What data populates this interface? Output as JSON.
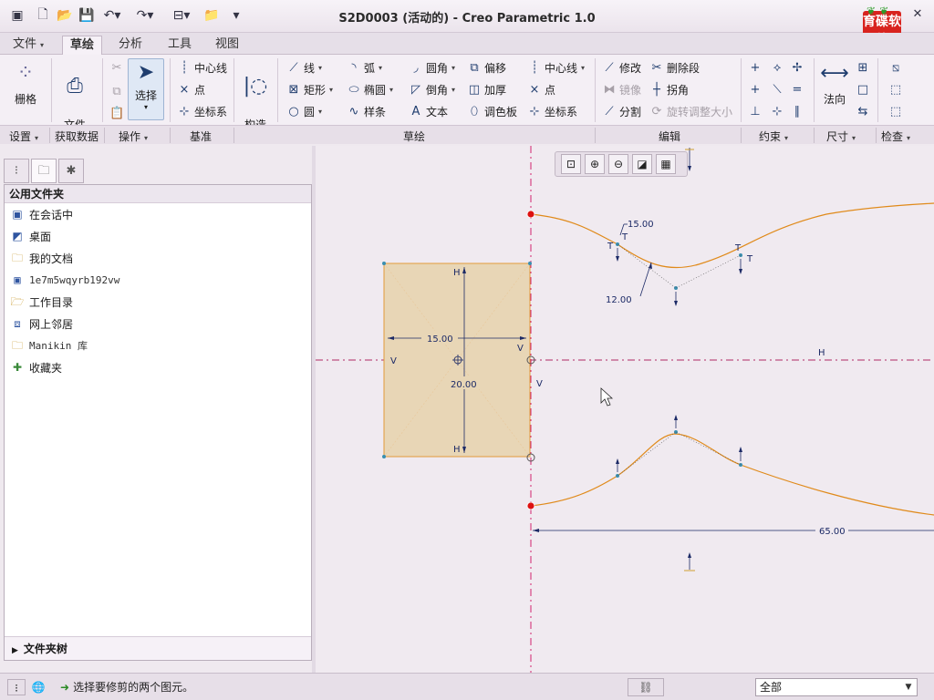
{
  "window": {
    "title": "S2D0003 (活动的) - Creo Parametric 1.0"
  },
  "logo": {
    "text": "育碟软件"
  },
  "quick_access": [
    "app-icon",
    "new-icon",
    "open-icon",
    "save-icon",
    "undo-icon",
    "redo-icon",
    "window-icon",
    "folder-icon",
    "customize-icon"
  ],
  "menu": {
    "tabs": [
      {
        "label": "文件"
      },
      {
        "label": "草绘"
      },
      {
        "label": "分析"
      },
      {
        "label": "工具"
      },
      {
        "label": "视图"
      }
    ]
  },
  "ribbon": {
    "grid": "栅格",
    "file_system": "文件\n系统",
    "select": "选择",
    "centerline": "中心线",
    "point": "点",
    "coordsys": "坐标系",
    "construct_mode": "构造\n模式",
    "sketch": {
      "line": "线",
      "rectangle": "矩形",
      "circle": "圆",
      "arc": "弧",
      "ellipse": "椭圆",
      "spline": "样条",
      "fillet": "圆角",
      "chamfer": "倒角",
      "text": "文本",
      "offset": "偏移",
      "thicken": "加厚",
      "palette": "调色板",
      "centerline2": "中心线",
      "point2": "点",
      "coordsys2": "坐标系"
    },
    "edit": {
      "modify": "修改",
      "mirror": "镜像",
      "divide": "分割",
      "delete_segment": "删除段",
      "corner": "拐角",
      "rotate_resize": "旋转调整大小"
    },
    "normal": "法向",
    "groups": {
      "setup": "设置",
      "get_data": "获取数据",
      "operations": "操作",
      "datum": "基准",
      "sketching": "草绘",
      "editing": "编辑",
      "constrain": "约束",
      "dimension": "尺寸",
      "inspect": "检查"
    }
  },
  "navigator": {
    "header": "公用文件夹",
    "items": [
      {
        "label": "在会话中",
        "icon": "monitor-icon"
      },
      {
        "label": "桌面",
        "icon": "desktop-icon"
      },
      {
        "label": "我的文档",
        "icon": "documents-icon"
      },
      {
        "label": "1e7m5wqyrb192vw",
        "icon": "computer-icon"
      },
      {
        "label": "工作目录",
        "icon": "work-folder-icon"
      },
      {
        "label": "网上邻居",
        "icon": "network-icon"
      },
      {
        "label": "Manikin 库",
        "icon": "library-folder-icon"
      },
      {
        "label": "收藏夹",
        "icon": "favorites-icon"
      }
    ],
    "folder_tree": "文件夹树"
  },
  "sketch": {
    "dims": {
      "d15_upper": "15.00",
      "d12": "12.00",
      "d15_rect": "15.00",
      "d20": "20.00",
      "d65": "65.00"
    },
    "constraints": {
      "H": "H",
      "V": "V",
      "T": "T"
    }
  },
  "status": {
    "message": "选择要修剪的两个图元。",
    "filter": "全部"
  }
}
